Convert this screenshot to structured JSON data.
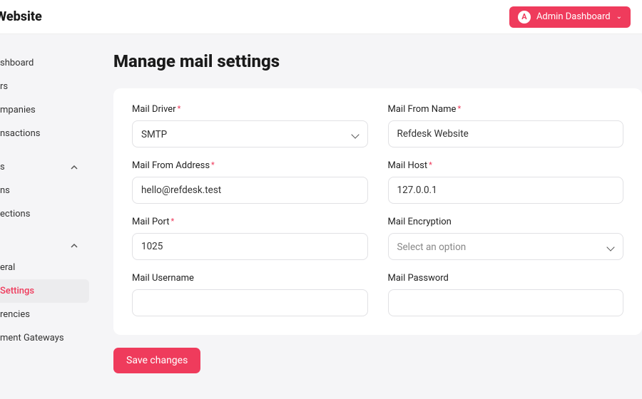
{
  "header": {
    "logo": "sk Website",
    "admin": {
      "initial": "A",
      "label": "Admin Dashboard"
    }
  },
  "sidebar": {
    "group1": [
      "shboard",
      "rs",
      "mpanies",
      "nsactions"
    ],
    "group2_header": "s",
    "group2": [
      "ns",
      "ections"
    ],
    "group3_header": "",
    "group3": [
      "eral",
      "Settings",
      "rencies",
      "ment Gateways"
    ],
    "active_index": 1
  },
  "page": {
    "title": "Manage mail settings"
  },
  "form": {
    "mail_driver": {
      "label": "Mail Driver",
      "value": "SMTP",
      "required": true
    },
    "mail_from_name": {
      "label": "Mail From Name",
      "value": "Refdesk Website",
      "required": true
    },
    "mail_from_address": {
      "label": "Mail From Address",
      "value": "hello@refdesk.test",
      "required": true
    },
    "mail_host": {
      "label": "Mail Host",
      "value": "127.0.0.1",
      "required": true
    },
    "mail_port": {
      "label": "Mail Port",
      "value": "1025",
      "required": true
    },
    "mail_encryption": {
      "label": "Mail Encryption",
      "value": "Select an option",
      "required": false
    },
    "mail_username": {
      "label": "Mail Username",
      "value": "",
      "required": false
    },
    "mail_password": {
      "label": "Mail Password",
      "value": "",
      "required": false
    }
  },
  "actions": {
    "save": "Save changes"
  }
}
